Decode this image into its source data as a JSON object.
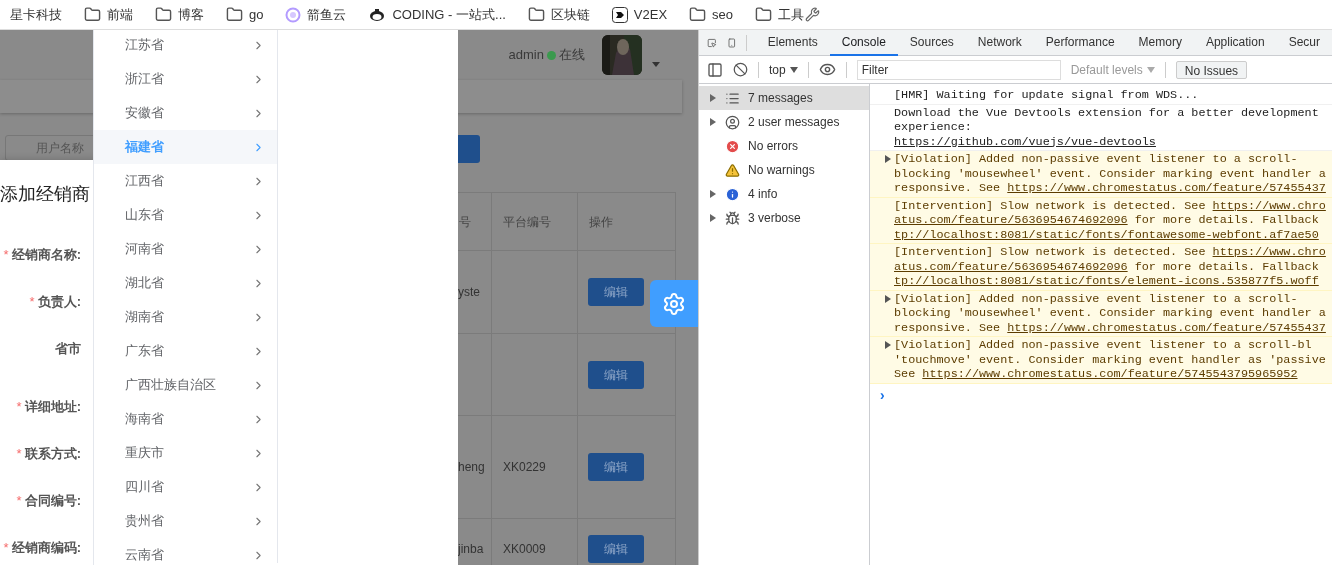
{
  "bookmarks": [
    {
      "label": "星卡科技",
      "kind": "plain",
      "tool": false
    },
    {
      "label": "前端",
      "kind": "folder",
      "tool": false
    },
    {
      "label": "博客",
      "kind": "folder",
      "tool": false
    },
    {
      "label": "go",
      "kind": "folder",
      "tool": false
    },
    {
      "label": "箭鱼云",
      "kind": "ring",
      "tool": false
    },
    {
      "label": "CODING - 一站式...",
      "kind": "mascot",
      "tool": false
    },
    {
      "label": "区块链",
      "kind": "folder",
      "tool": false
    },
    {
      "label": "V2EX",
      "kind": "logo",
      "tool": false
    },
    {
      "label": "seo",
      "kind": "folder",
      "tool": false
    },
    {
      "label": "工具",
      "kind": "folder",
      "tool": true
    }
  ],
  "app": {
    "header": {
      "user": "admin",
      "status": "在线",
      "online": true
    },
    "search": {
      "placeholder": "用户名称"
    },
    "table": {
      "columns": [
        "号",
        "平台编号",
        "操作"
      ],
      "rows": [
        {
          "cells": [
            "yste",
            ""
          ],
          "action": "编辑"
        },
        {
          "cells": [
            "",
            ""
          ],
          "action": "编辑"
        },
        {
          "cells": [
            "heng",
            "XK0229"
          ],
          "action": "编辑"
        },
        {
          "cells": [
            "jinba",
            "XK0009"
          ],
          "action": "编辑"
        }
      ]
    }
  },
  "drawer": {
    "title": "添加经销商",
    "fields": [
      {
        "label": "经销商名称:",
        "required_mark": "*",
        "kind": "text"
      },
      {
        "label": "负责人:",
        "required_mark": "*",
        "kind": "text"
      },
      {
        "label": "省市",
        "kind": "select"
      },
      {
        "label": "详细地址:",
        "required_mark": "*",
        "kind": "text"
      },
      {
        "label": "联系方式:",
        "required_mark": "*",
        "kind": "text"
      },
      {
        "label": "合同编号:",
        "required_mark": "*",
        "kind": "text"
      },
      {
        "label": "经销商编码:",
        "required_mark": "*",
        "kind": "text"
      }
    ]
  },
  "cascader": {
    "items": [
      {
        "label": "江苏省",
        "selected": false
      },
      {
        "label": "浙江省",
        "selected": false
      },
      {
        "label": "安徽省",
        "selected": false
      },
      {
        "label": "福建省",
        "selected": true
      },
      {
        "label": "江西省",
        "selected": false
      },
      {
        "label": "山东省",
        "selected": false
      },
      {
        "label": "河南省",
        "selected": false
      },
      {
        "label": "湖北省",
        "selected": false
      },
      {
        "label": "湖南省",
        "selected": false
      },
      {
        "label": "广东省",
        "selected": false
      },
      {
        "label": "广西壮族自治区",
        "selected": false
      },
      {
        "label": "海南省",
        "selected": false
      },
      {
        "label": "重庆市",
        "selected": false
      },
      {
        "label": "四川省",
        "selected": false
      },
      {
        "label": "贵州省",
        "selected": false
      },
      {
        "label": "云南省",
        "selected": false
      }
    ]
  },
  "devtools": {
    "tabs": [
      {
        "label": "Elements",
        "selected": false
      },
      {
        "label": "Console",
        "selected": true
      },
      {
        "label": "Sources",
        "selected": false
      },
      {
        "label": "Network",
        "selected": false
      },
      {
        "label": "Performance",
        "selected": false
      },
      {
        "label": "Memory",
        "selected": false
      },
      {
        "label": "Application",
        "selected": false
      },
      {
        "label": "Secur",
        "selected": false
      }
    ],
    "toolbar": {
      "context": "top",
      "filter_placeholder": "Filter",
      "levels": "Default levels",
      "issues": "No Issues"
    },
    "sidebar": [
      {
        "label": "7 messages",
        "kind": "list",
        "expandable": true,
        "selected": true
      },
      {
        "label": "2 user messages",
        "kind": "user",
        "expandable": true,
        "selected": false
      },
      {
        "label": "No errors",
        "kind": "error",
        "expandable": false,
        "selected": false
      },
      {
        "label": "No warnings",
        "kind": "warning",
        "expandable": false,
        "selected": false
      },
      {
        "label": "4 info",
        "kind": "info",
        "expandable": true,
        "selected": false
      },
      {
        "label": "3 verbose",
        "kind": "verbose",
        "expandable": true,
        "selected": false
      }
    ],
    "messages": [
      {
        "kind": "log",
        "expandable": false,
        "lines": [
          [
            {
              "text": "[HMR] Waiting for update signal from WDS...",
              "link": false
            }
          ]
        ]
      },
      {
        "kind": "log",
        "expandable": false,
        "lines": [
          [
            {
              "text": "Download the Vue Devtools extension for a better development",
              "link": false
            }
          ],
          [
            {
              "text": "experience:",
              "link": false
            }
          ],
          [
            {
              "text": "https://github.com/vuejs/vue-devtools",
              "link": true
            }
          ]
        ]
      },
      {
        "kind": "warning",
        "expandable": true,
        "lines": [
          [
            {
              "text": "[Violation] Added non-passive event listener to a scroll-",
              "link": false
            }
          ],
          [
            {
              "text": "blocking 'mousewheel' event. Consider marking event handler a",
              "link": false
            }
          ],
          [
            {
              "text": "responsive. See ",
              "link": false
            },
            {
              "text": "https://www.chromestatus.com/feature/57455437",
              "link": true
            }
          ]
        ]
      },
      {
        "kind": "warning",
        "expandable": false,
        "lines": [
          [
            {
              "text": "[Intervention] Slow network is detected. See ",
              "link": false
            },
            {
              "text": "https://www.chro",
              "link": true
            }
          ],
          [
            {
              "text": "atus.com/feature/5636954674692096",
              "link": true
            },
            {
              "text": " for more details. Fallback",
              "link": false
            }
          ],
          [
            {
              "text": "tp://localhost:8081/static/fonts/fontawesome-webfont.af7ae50",
              "link": true
            }
          ]
        ]
      },
      {
        "kind": "warning",
        "expandable": false,
        "lines": [
          [
            {
              "text": "[Intervention] Slow network is detected. See ",
              "link": false
            },
            {
              "text": "https://www.chro",
              "link": true
            }
          ],
          [
            {
              "text": "atus.com/feature/5636954674692096",
              "link": true
            },
            {
              "text": " for more details. Fallback",
              "link": false
            }
          ],
          [
            {
              "text": "tp://localhost:8081/static/fonts/element-icons.535877f5.woff",
              "link": true
            }
          ]
        ]
      },
      {
        "kind": "warning",
        "expandable": true,
        "lines": [
          [
            {
              "text": "[Violation] Added non-passive event listener to a scroll-",
              "link": false
            }
          ],
          [
            {
              "text": "blocking 'mousewheel' event. Consider marking event handler a",
              "link": false
            }
          ],
          [
            {
              "text": "responsive. See ",
              "link": false
            },
            {
              "text": "https://www.chromestatus.com/feature/57455437",
              "link": true
            }
          ]
        ]
      },
      {
        "kind": "warning",
        "expandable": true,
        "lines": [
          [
            {
              "text": "[Violation] Added non-passive event listener to a scroll-bl",
              "link": false
            }
          ],
          [
            {
              "text": "'touchmove' event. Consider marking event handler as 'passive",
              "link": false
            }
          ],
          [
            {
              "text": "See ",
              "link": false
            },
            {
              "text": "https://www.chromestatus.com/feature/5745543795965952",
              "link": true
            }
          ]
        ]
      }
    ],
    "prompt": "›"
  }
}
